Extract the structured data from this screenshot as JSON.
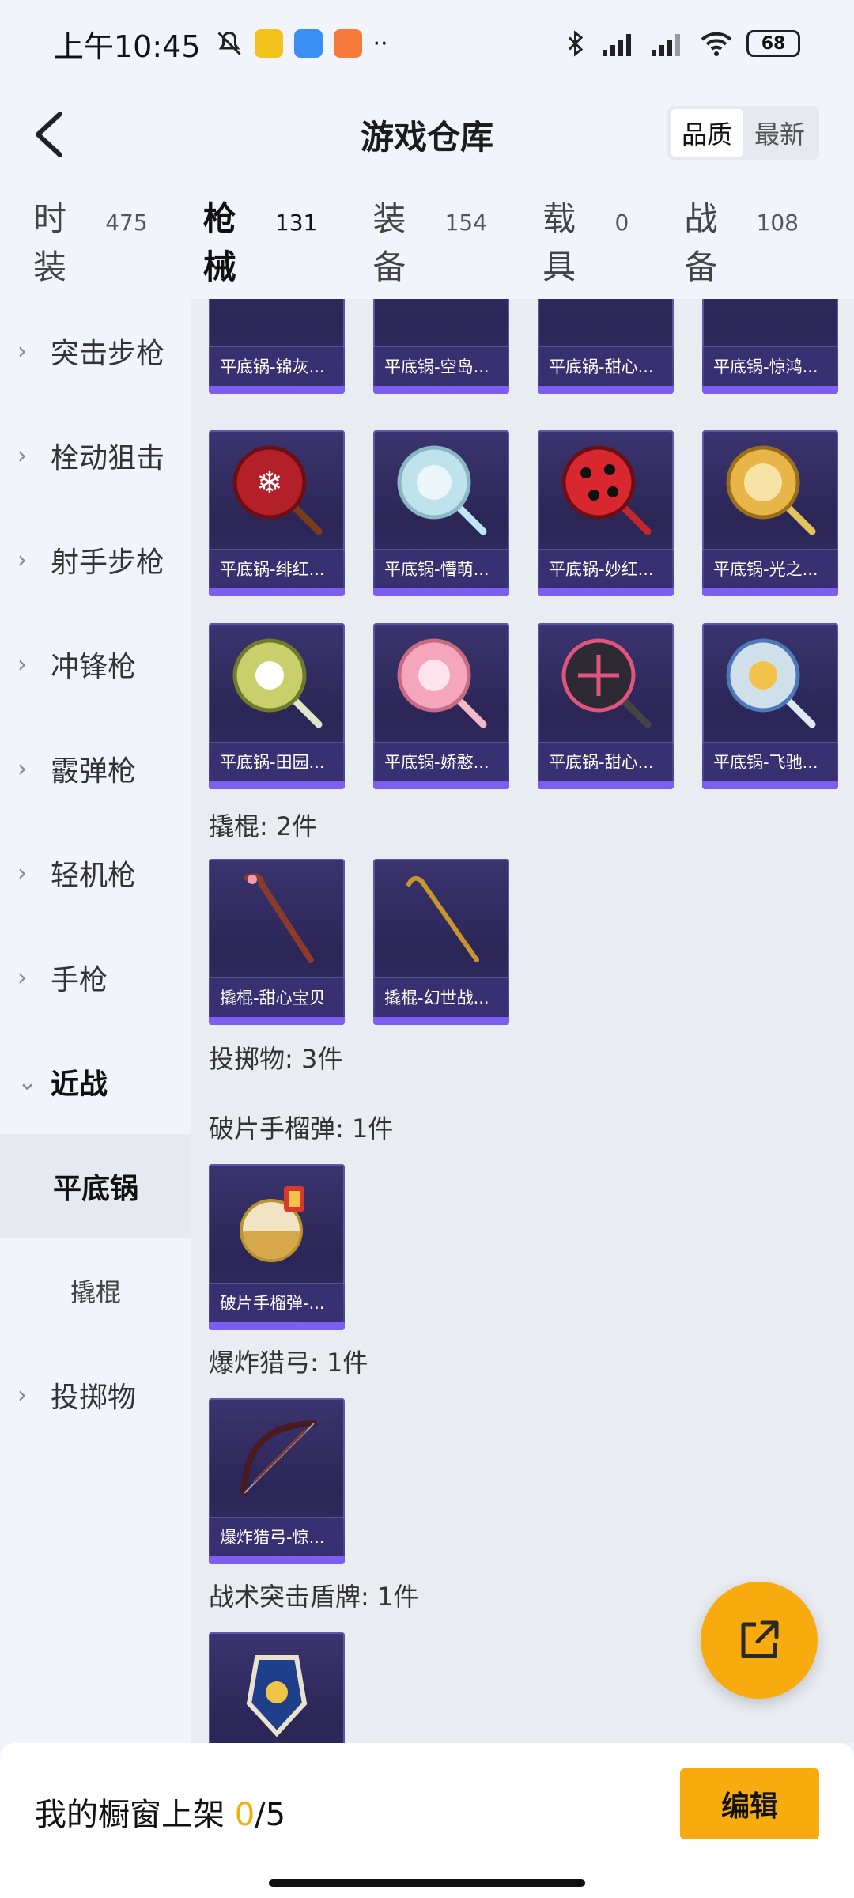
{
  "status_bar": {
    "time": "上午10:45",
    "battery": "68"
  },
  "header": {
    "title": "游戏仓库",
    "sort_options": [
      "品质",
      "最新"
    ]
  },
  "tabs": [
    {
      "label": "时装",
      "count": "475"
    },
    {
      "label": "枪械",
      "count": "131"
    },
    {
      "label": "装备",
      "count": "154"
    },
    {
      "label": "载具",
      "count": "0"
    },
    {
      "label": "战备",
      "count": "108"
    }
  ],
  "sidebar": [
    {
      "label": "突击步枪"
    },
    {
      "label": "栓动狙击"
    },
    {
      "label": "射手步枪"
    },
    {
      "label": "冲锋枪"
    },
    {
      "label": "霰弹枪"
    },
    {
      "label": "轻机枪"
    },
    {
      "label": "手枪"
    },
    {
      "label": "近战"
    },
    {
      "label": "平底锅"
    },
    {
      "label": "撬棍"
    },
    {
      "label": "投掷物"
    }
  ],
  "cards": [
    {
      "name": "平底锅-锦灰...",
      "icon": "pan"
    },
    {
      "name": "平底锅-空岛...",
      "icon": "pan"
    },
    {
      "name": "平底锅-甜心...",
      "icon": "pan"
    },
    {
      "name": "平底锅-惊鸿...",
      "icon": "pan"
    },
    {
      "name": "平底锅-绯红...",
      "icon": "pan"
    },
    {
      "name": "平底锅-懵萌...",
      "icon": "pan"
    },
    {
      "name": "平底锅-妙红...",
      "icon": "pan"
    },
    {
      "name": "平底锅-光之...",
      "icon": "pan"
    },
    {
      "name": "平底锅-田园...",
      "icon": "pan"
    },
    {
      "name": "平底锅-娇憨...",
      "icon": "pan"
    },
    {
      "name": "平底锅-甜心...",
      "icon": "pan"
    },
    {
      "name": "平底锅-飞驰...",
      "icon": "pan"
    },
    {
      "name": "撬棍-甜心宝贝",
      "icon": "crowbar"
    },
    {
      "name": "撬棍-幻世战...",
      "icon": "crowbar"
    },
    {
      "name": "破片手榴弹-...",
      "icon": "grenade"
    },
    {
      "name": "爆炸猎弓-惊...",
      "icon": "bow"
    },
    {
      "name": "",
      "icon": "shield"
    }
  ],
  "sections": [
    "撬棍: 2件",
    "投掷物: 3件",
    "破片手榴弹: 1件",
    "爆炸猎弓: 1件",
    "战术突击盾牌: 1件"
  ],
  "bottom_bar": {
    "label": "我的橱窗上架",
    "current": "0",
    "total": "/5",
    "edit_label": "编辑"
  },
  "colors": {
    "accent": "#f7ab0e",
    "card_bg": "#2b2656",
    "card_strip": "#7c5ff0"
  }
}
